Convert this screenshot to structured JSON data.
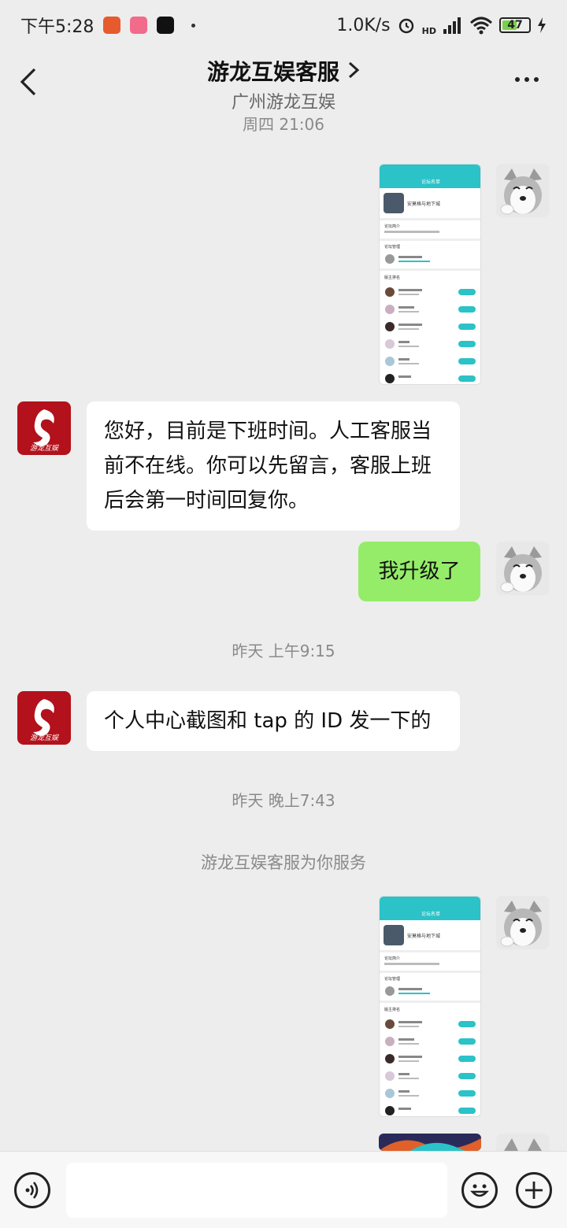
{
  "status_bar": {
    "time": "下午5:28",
    "network_speed": "1.0K/s",
    "hd_label": "HD",
    "battery": "47"
  },
  "header": {
    "title": "游龙互娱客服",
    "subtitle": "广州游龙互娱"
  },
  "messages": {
    "ts_top": "周四 21:06",
    "auto_reply": "您好，目前是下班时间。人工客服当前不在线。你可以先留言，客服上班后会第一时间回复你。",
    "user_msg": "我升级了",
    "ts_1": "昨天 上午9:15",
    "agent_msg": "个人中心截图和 tap 的 ID 发一下的",
    "ts_2": "昨天 晚上7:43",
    "system_notice": "游龙互娱客服为你服务"
  },
  "agent_logo_text": "游龙互娱",
  "screenshot": {
    "header": "论坛名单",
    "group_name": "安莫格与地下城",
    "section_intro": "论坛简介",
    "section_mod": "论坛管理",
    "section_members": "版主排名",
    "follow": "关注"
  },
  "colors": {
    "background": "#ededed",
    "bubble_in": "#ffffff",
    "bubble_out": "#95ec69",
    "teal": "#2bc2c8",
    "agent_logo": "#b3111b"
  },
  "icons": {
    "back": "chevron-left-icon",
    "more": "more-dots-icon",
    "voice": "voice-icon",
    "emoji": "emoji-icon",
    "plus": "plus-icon"
  }
}
